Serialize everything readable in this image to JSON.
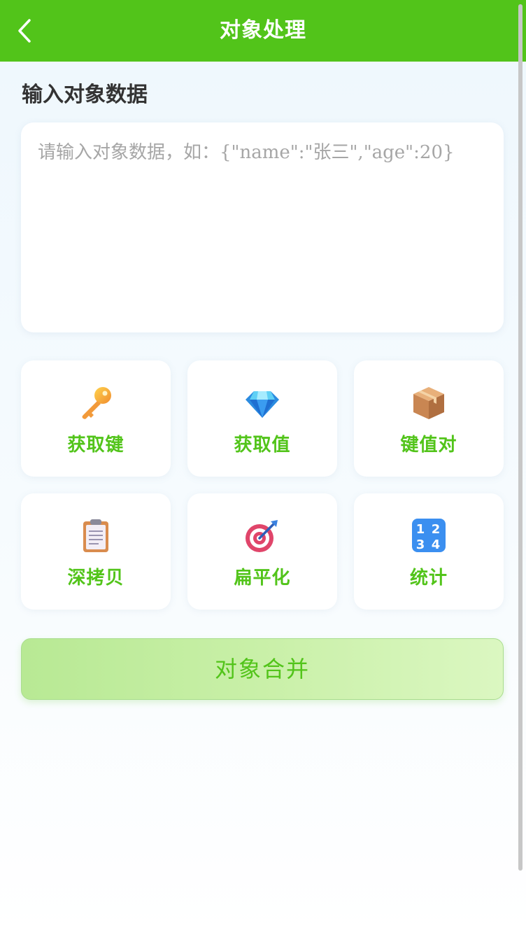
{
  "header": {
    "title": "对象处理",
    "back_icon": "chevron-left-icon"
  },
  "input_section": {
    "title": "输入对象数据",
    "value": "",
    "placeholder": "请输入对象数据，如：{\"name\":\"张三\",\"age\":20}"
  },
  "actions": [
    {
      "label": "获取键",
      "icon": "key-icon"
    },
    {
      "label": "获取值",
      "icon": "gem-icon"
    },
    {
      "label": "键值对",
      "icon": "package-icon"
    },
    {
      "label": "深拷贝",
      "icon": "clipboard-icon"
    },
    {
      "label": "扁平化",
      "icon": "target-icon"
    },
    {
      "label": "统计",
      "icon": "numbers-icon"
    }
  ],
  "merge_button": {
    "label": "对象合并"
  },
  "colors": {
    "accent": "#52c41a",
    "header_bg": "#52c41a",
    "title_text": "#333333",
    "placeholder": "#a6a6a6"
  }
}
